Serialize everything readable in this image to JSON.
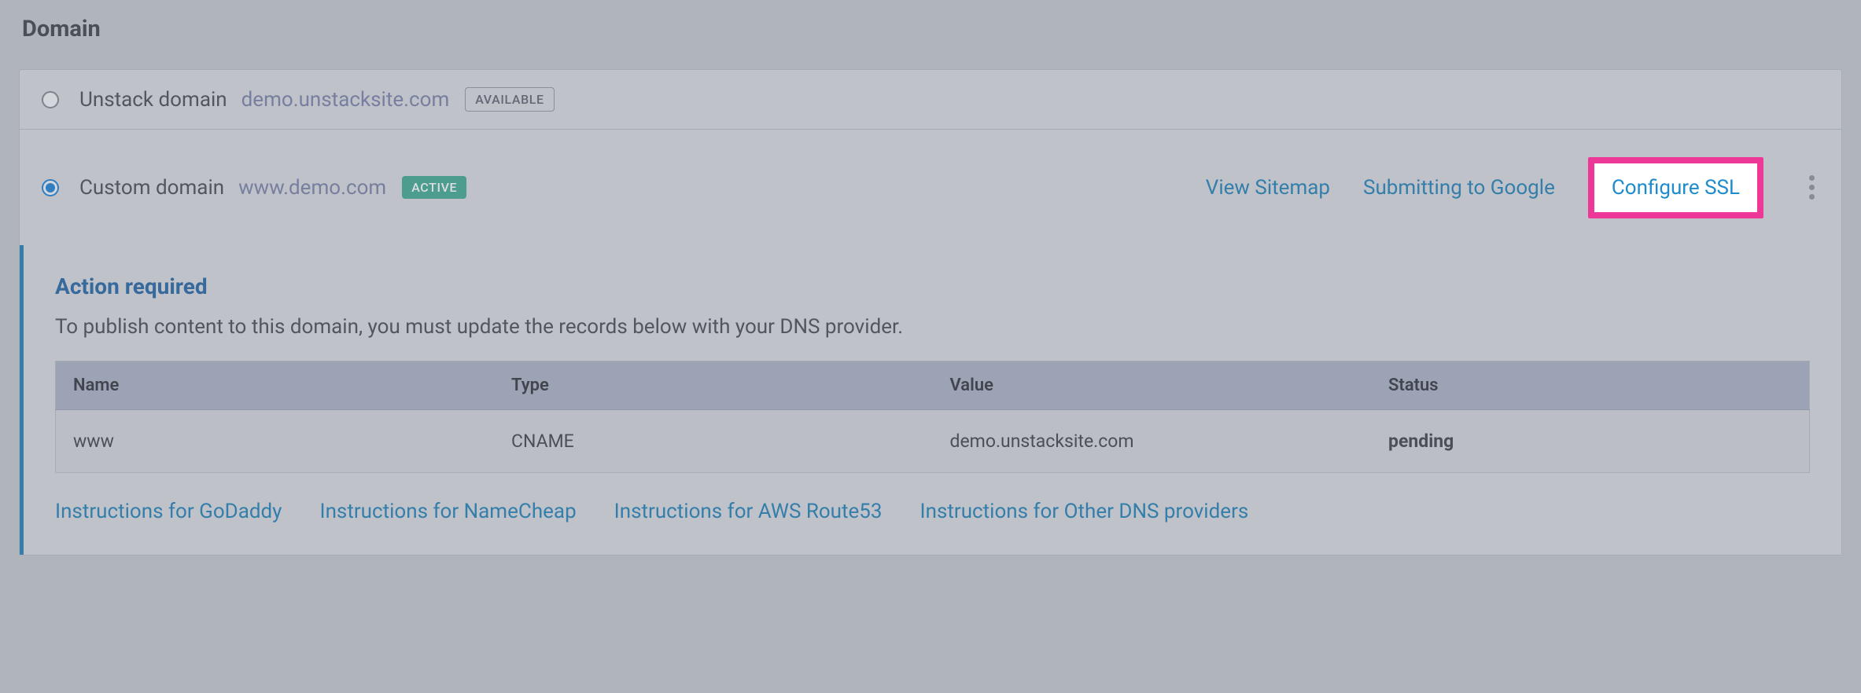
{
  "section": {
    "title": "Domain"
  },
  "unstack": {
    "label": "Unstack domain",
    "url": "demo.unstacksite.com",
    "badge": "AVAILABLE"
  },
  "custom": {
    "label": "Custom domain",
    "url": "www.demo.com",
    "badge": "ACTIVE"
  },
  "actions": {
    "sitemap": "View Sitemap",
    "submit_google": "Submitting to Google",
    "configure_ssl": "Configure SSL"
  },
  "notice": {
    "title": "Action required",
    "description": "To publish content to this domain, you must update the records below with your DNS provider."
  },
  "dns_table": {
    "headers": {
      "name": "Name",
      "type": "Type",
      "value": "Value",
      "status": "Status"
    },
    "rows": [
      {
        "name": "www",
        "type": "CNAME",
        "value": "demo.unstacksite.com",
        "status": "pending"
      }
    ]
  },
  "instructions": {
    "godaddy": "Instructions for GoDaddy",
    "namecheap": "Instructions for NameCheap",
    "route53": "Instructions for AWS Route53",
    "other": "Instructions for Other DNS providers"
  }
}
